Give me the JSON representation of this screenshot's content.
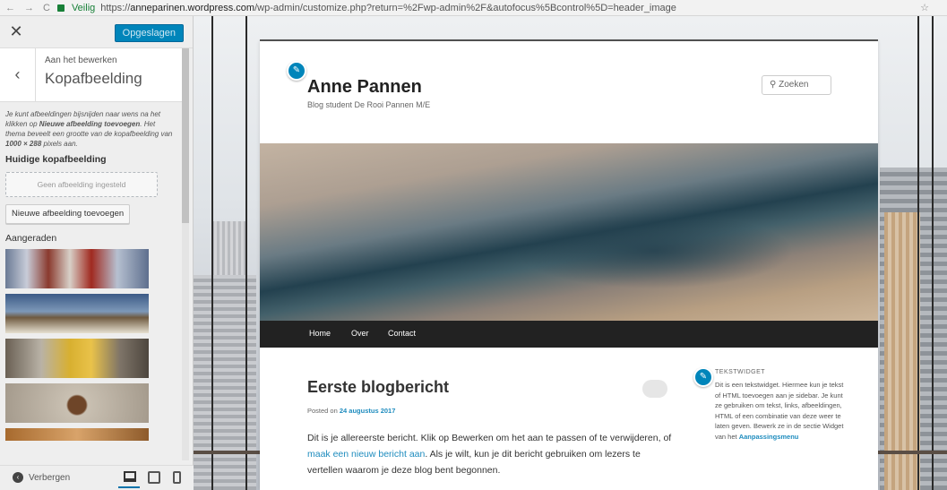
{
  "browser": {
    "security": "Veilig",
    "url_scheme": "https://",
    "url_host": "anneparinen.wordpress.com",
    "url_path": "/wp-admin/customize.php?return=%2Fwp-admin%2F&autofocus%5Bcontrol%5D=header_image"
  },
  "customizer": {
    "saved_label": "Opgeslagen",
    "breadcrumb": "Aan het bewerken",
    "panel_title": "Kopafbeelding",
    "description_1": "Je kunt afbeeldingen bijsnijden naar wens na het klikken op ",
    "description_bold_1": "Nieuwe afbeelding toevoegen",
    "description_2": ". Het thema beveelt een grootte van de kopafbeelding van ",
    "description_bold_2": "1000 × 288",
    "description_3": " pixels aan.",
    "current_header_label": "Huidige kopafbeelding",
    "no_image_label": "Geen afbeelding ingesteld",
    "add_new_label": "Nieuwe afbeelding toevoegen",
    "suggested_label": "Aangeraden",
    "hide_label": "Verbergen"
  },
  "site": {
    "title": "Anne Pannen",
    "tagline": "Blog student De Rooi Pannen M/E",
    "search_placeholder": "Zoeken",
    "nav": [
      "Home",
      "Over",
      "Contact"
    ],
    "post": {
      "title": "Eerste blogbericht",
      "posted_prefix": "Posted on ",
      "date": "24 augustus 2017",
      "body_1": "Dit is je allereerste bericht. Klik op Bewerken om het aan te passen of te verwijderen, of ",
      "body_link": "maak een nieuw bericht aan",
      "body_2": ". Als je wilt, kun je dit bericht gebruiken om lezers te vertellen waarom je deze blog bent begonnen."
    },
    "widget": {
      "title": "TEKSTWIDGET",
      "text": "Dit is een tekstwidget. Hiermee kun je tekst of HTML toevoegen aan je sidebar. Je kunt ze gebruiken om tekst, links, afbeeldingen, HTML of een combinatie van deze weer te laten geven. Bewerk ze in de sectie Widget van het ",
      "link": "Aanpassingsmenu"
    }
  },
  "colors": {
    "primary_button": "#0085ba",
    "link": "#1e8cbe",
    "navbar": "#222222"
  }
}
